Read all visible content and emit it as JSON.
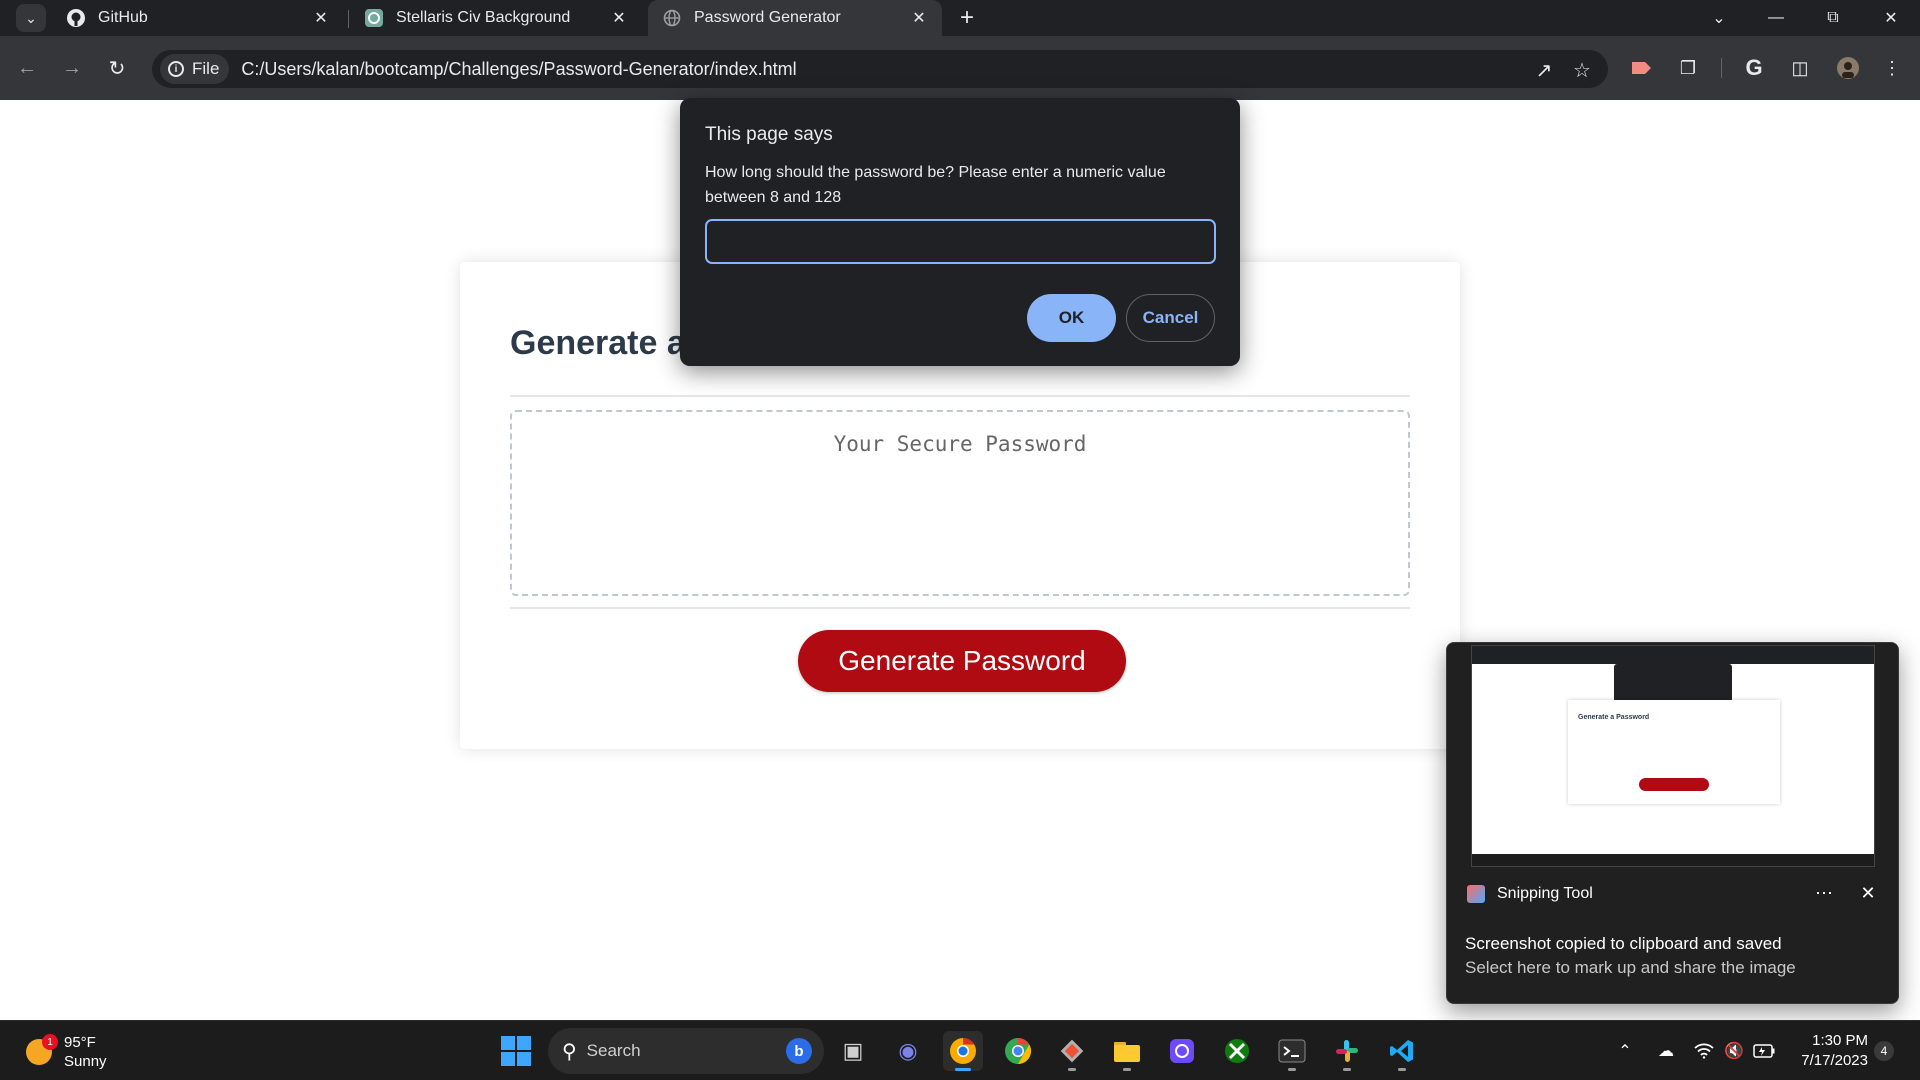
{
  "browser": {
    "tabs": [
      {
        "title": "GitHub",
        "icon": "github-icon",
        "active": false
      },
      {
        "title": "Stellaris Civ Background",
        "icon": "chatgpt-icon",
        "active": false
      },
      {
        "title": "Password Generator",
        "icon": "globe-icon",
        "active": true
      }
    ],
    "address": {
      "scheme_chip": "File",
      "url": "C:/Users/kalan/bootcamp/Challenges/Password-Generator/index.html"
    },
    "colors": {
      "frame": "#202124",
      "toolbar": "#35363a"
    }
  },
  "page": {
    "header": "Generate a Password",
    "password_placeholder": "Your Secure Password",
    "generate_button": "Generate Password",
    "colors": {
      "button": "#b00a12",
      "header": "#2d3a4a"
    }
  },
  "dialog": {
    "title": "This page says",
    "message": "How long should the password be? Please enter a numeric value between 8 and 128",
    "input_value": "",
    "ok_label": "OK",
    "cancel_label": "Cancel",
    "colors": {
      "accent": "#8ab4f8",
      "background": "#202124"
    }
  },
  "toast": {
    "app_name": "Snipping Tool",
    "title": "Screenshot copied to clipboard and saved",
    "subtitle": "Select here to mark up and share the image",
    "thumbnail_header": "Generate a Password"
  },
  "taskbar": {
    "weather": {
      "temp": "95°F",
      "condition": "Sunny",
      "badge": "1"
    },
    "search_label": "Search",
    "apps": [
      "task-view-icon",
      "teams-icon",
      "chrome-dev-icon",
      "chrome-icon",
      "git-icon",
      "file-explorer-icon",
      "proton-vpn-icon",
      "xbox-icon",
      "terminal-icon",
      "slack-icon",
      "vscode-icon"
    ],
    "clock": {
      "time": "1:30 PM",
      "date": "7/17/2023"
    },
    "notification_count": "4"
  }
}
